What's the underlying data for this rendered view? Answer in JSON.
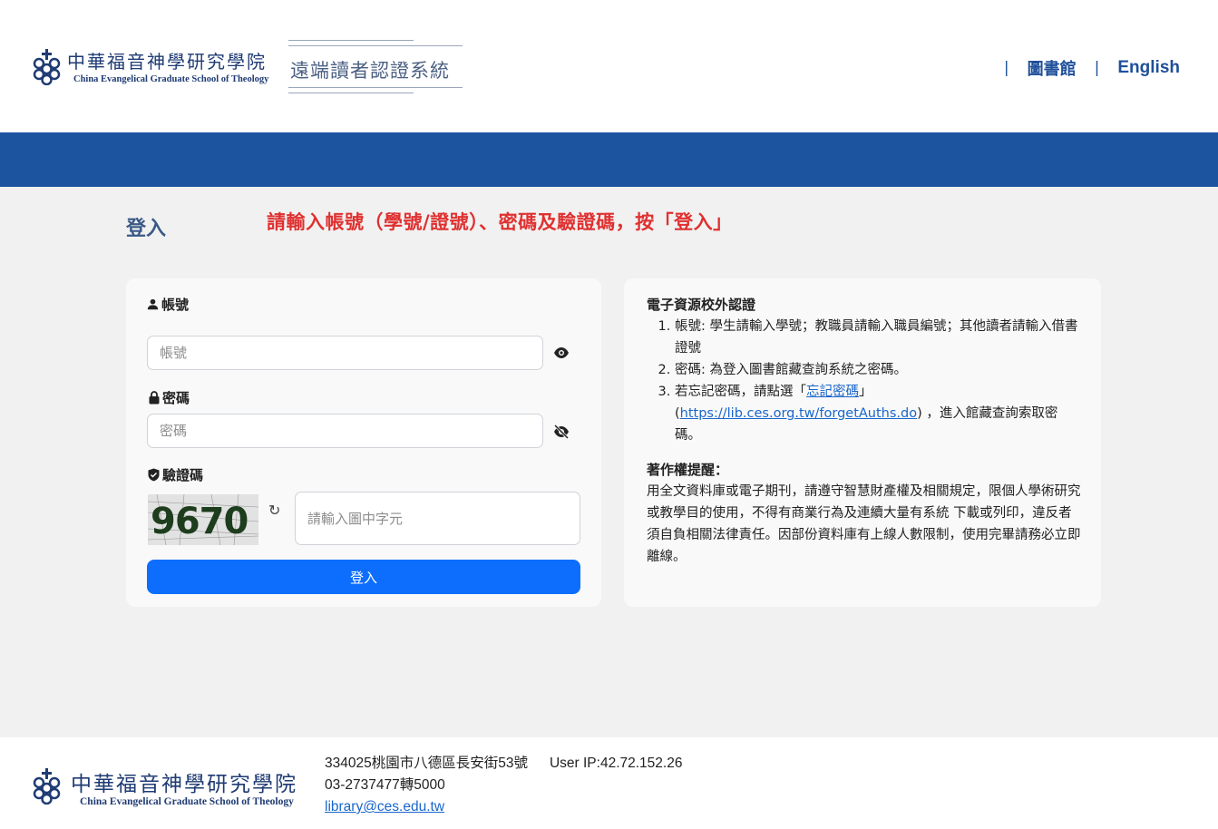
{
  "header": {
    "logo_cn": "中華福音神學研究學院",
    "logo_en": "China Evangelical  Graduate School of Theology",
    "system_title": "遠端讀者認證系統",
    "nav": {
      "library": "圖書館",
      "english": "English"
    }
  },
  "main": {
    "page_title": "登入",
    "notice": "請輸入帳號（學號/證號）、密碼及驗證碼，按「登入」"
  },
  "login": {
    "account_label": "帳號",
    "account_placeholder": "帳號",
    "password_label": "密碼",
    "password_placeholder": "密碼",
    "captcha_label": "驗證碼",
    "captcha_text": "9670",
    "captcha_placeholder": "請輸入圖中字元",
    "submit_label": "登入"
  },
  "info": {
    "title": "電子資源校外認證",
    "items": [
      "帳號: 學生請輸入學號；教職員請輸入職員編號；其他讀者請輸入借書證號",
      "密碼: 為登入圖書館藏查詢系統之密碼。"
    ],
    "item3_prefix": "若忘記密碼，請點選「",
    "item3_link": "忘記密碼",
    "item3_mid": "」(",
    "item3_url": "https://lib.ces.org.tw/forgetAuths.do",
    "item3_suffix": ") ，進入館藏查詢索取密碼。",
    "copyright_title": "著作權提醒：",
    "copyright_text": "用全文資料庫或電子期刊，請遵守智慧財產權及相關規定，限個人學術研究或教學目的使用，不得有商業行為及連續大量有系統 下載或列印，違反者須自負相關法律責任。因部份資料庫有上線人數限制，使用完畢請務必立即離線。"
  },
  "footer": {
    "address": "334025桃園市八德區長安街53號",
    "user_ip": "User IP:42.72.152.26",
    "phone": "03-2737477轉5000",
    "email": "library@ces.edu.tw"
  },
  "colors": {
    "brand_blue": "#1c54a0",
    "button_blue": "#0d6efd",
    "notice_red": "#e03030"
  }
}
